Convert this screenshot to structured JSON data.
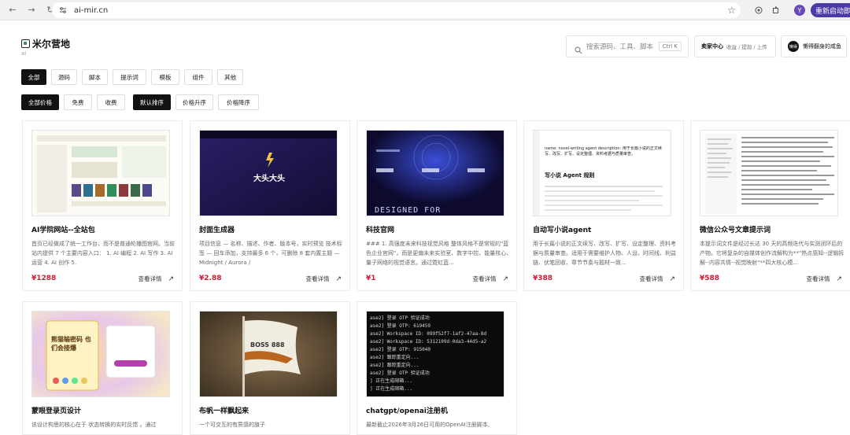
{
  "browser": {
    "url": "ai-mir.cn",
    "restart_label": "重新启动即可",
    "profile_initial": "Y"
  },
  "header": {
    "site_name": "米尔营地",
    "site_sub": "ai",
    "search_placeholder": "搜索源码、工具、脚本",
    "search_shortcut": "Ctrl K",
    "seller_center": "卖家中心",
    "seller_links": "收益 / 提现 / 上传",
    "user_avatar_text": "懒得",
    "user_name": "懒得翻身的咸鱼"
  },
  "filters": {
    "categories": [
      "全部",
      "源码",
      "脚本",
      "提示词",
      "模板",
      "组件",
      "其他"
    ],
    "active_category": 0,
    "price_filters": [
      "全部价格",
      "免费",
      "收费"
    ],
    "active_price": 0,
    "sort_options": [
      "默认排序",
      "价格升序",
      "价格降序"
    ],
    "active_sort": 0
  },
  "products": [
    {
      "title": "AI学院网站--全站包",
      "desc": "首页已经做成了统一工作台，而不是普通轮播图官网。当前站内提供 7 个主要内容入口： 1. AI 编程 2. AI 写作 3. AI 运营 4. AI 创作 5.",
      "price": "¥1288",
      "more": "查看详情"
    },
    {
      "title": "封面生成器",
      "desc": "项目信息 — 名称、描述、作者、版本号，实时预览 技术标签 — 回车添加，支持最多 6 个，可删除 8 套内置主题 — Midnight / Aurora /",
      "price": "¥2.88",
      "more": "查看详情",
      "thumb_text": "大头大头"
    },
    {
      "title": "科技官网",
      "desc": "### 1. 高强度未来科技视觉风格 整体风格不是常规的\"蓝色企业官网\"，而是更偏未来实验室、数字中控、能量核心、量子网络的视觉语言。通过霓虹蓝...",
      "price": "¥1",
      "more": "查看详情",
      "thumb_text": "DESIGNED FOR"
    },
    {
      "title": "自动写小说agent",
      "desc": "用于长篇小说的正文续写、改写、扩写、设定整理、资料考据与质量审查。适用于需要维护人物、人设、时间线、利益链、伏笔回收、章节节奏与题材一致...",
      "price": "¥388",
      "more": "查看详情",
      "thumb_heading": "写小说 Agent 规则",
      "thumb_text": "name: novel-writing agent description: 用于长篇小说的正文续写、改写、扩写、设定整理、资料考据与质量审查。"
    },
    {
      "title": "微信公众号文章提示词",
      "desc": "本提示词文件是经过长达 30 天的高频迭代与实测闭环后的产物。它将复杂的自媒体创作流解构为**\"热点感知--逻辑拆解--内容共情--视觉映射\"**四大核心模...",
      "price": "¥588",
      "more": "查看详情"
    },
    {
      "title": "蒙眼登录页设计",
      "desc": "该设计构思的核心在于 状态转换的实时反馈 。通过",
      "price": "",
      "more": "",
      "thumb_text": "熊猫输密码 也们会接爆"
    },
    {
      "title": "布帆一样飘起来",
      "desc": "一个可交互的有质感的旗子",
      "price": "",
      "more": "",
      "thumb_text": "BOSS 888"
    },
    {
      "title": "chatgpt/openai注册机",
      "desc": "最新截止2026年3月26日可用的OpenAI注册脚本,",
      "price": "",
      "more": "",
      "terminal_lines": [
        "ase2] 登录 OTP 验证成功",
        "ase2] 登录 OTP: 619459",
        "ase2] Workspace ID: 099f52f7-1af2-47aa-8d",
        "ase2] Workspace ID: 5312109d-0da3-44d5-a2",
        "ase2] 登录 OTP: 915040",
        "ase2] 跟踪重定向...",
        "ase2] 跟踪重定向...",
        "ase2] 登录 OTP 验证成功",
        "] 正在生成邮箱...",
        "] 正在生成邮箱..."
      ]
    }
  ],
  "colors": {
    "accent": "#111111",
    "price": "#d01b35",
    "restart_button": "#4a3aa8"
  }
}
